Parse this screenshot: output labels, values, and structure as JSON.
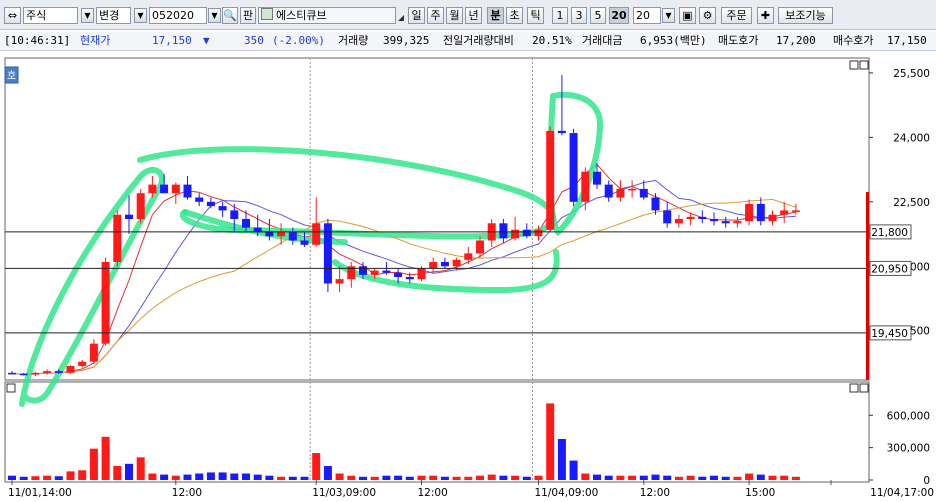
{
  "toolbar": {
    "market": "주식",
    "change_label": "변경",
    "code": "052020",
    "pan_label": "판",
    "stock_name": "에스티큐브",
    "period_buttons": [
      "일",
      "주",
      "월",
      "년",
      "분",
      "초",
      "틱"
    ],
    "minute_buttons": [
      "1",
      "3",
      "5",
      "20"
    ],
    "interval_value": "20",
    "order_label": "주문",
    "aux_label": "보조기능"
  },
  "quote": {
    "time": "[10:46:31]",
    "price_label": "현재가",
    "price": "17,150",
    "change_arrow": "▼",
    "change": "350",
    "change_pct": "(-2.00%)",
    "volume_label": "거래량",
    "volume": "399,325",
    "prev_vol_label": "전일거래량대비",
    "prev_vol_ratio": "20.51%",
    "amount_label": "거래대금",
    "amount": "6,953(백만)",
    "ask_label": "매도호가",
    "ask": "17,200",
    "bid_label": "매수호가",
    "bid": "17,150"
  },
  "chart": {
    "hoga_tab": "호",
    "colors": {
      "up": "#ff1a1a",
      "down": "#1a1aff",
      "highlight": "#33e68c"
    },
    "price_ticks": [
      {
        "value": 25500,
        "label": "25,500"
      },
      {
        "value": 24000,
        "label": "24,000"
      },
      {
        "value": 22500,
        "label": "22,500"
      },
      {
        "value": 21000,
        "label": "21,000"
      },
      {
        "value": 19500,
        "label": "19,500"
      }
    ],
    "price_lines": [
      {
        "value": 21800,
        "label": "21,800"
      },
      {
        "value": 20950,
        "label": "20,950"
      },
      {
        "value": 19450,
        "label": "19,450"
      }
    ],
    "volume_ticks": [
      {
        "value": 600000,
        "label": "600,000"
      },
      {
        "value": 300000,
        "label": "300,000"
      },
      {
        "value": 0,
        "label": "0"
      }
    ],
    "time_labels": [
      {
        "label": "11/01,14:00",
        "index": 0
      },
      {
        "label": "12:00",
        "index": 14
      },
      {
        "label": "11/03,09:00",
        "index": 26
      },
      {
        "label": "12:00",
        "index": 35
      },
      {
        "label": "11/04,09:00",
        "index": 45
      },
      {
        "label": "12:00",
        "index": 54
      },
      {
        "label": "15:00",
        "index": 63
      },
      {
        "label": "11/04,17:00",
        "index": 70
      }
    ]
  },
  "chart_data": {
    "type": "candlestick",
    "price_range": [
      18400,
      25800
    ],
    "volume_range": [
      0,
      760000
    ],
    "candles": [
      [
        18520,
        18560,
        18480,
        18500,
        40000
      ],
      [
        18500,
        18520,
        18460,
        18480,
        30000
      ],
      [
        18480,
        18540,
        18440,
        18520,
        35000
      ],
      [
        18520,
        18600,
        18480,
        18560,
        40000
      ],
      [
        18560,
        18600,
        18500,
        18520,
        35000
      ],
      [
        18520,
        18700,
        18500,
        18680,
        80000
      ],
      [
        18680,
        18820,
        18640,
        18780,
        90000
      ],
      [
        18780,
        19300,
        18720,
        19200,
        290000
      ],
      [
        19200,
        21200,
        19150,
        21100,
        400000
      ],
      [
        21100,
        22300,
        21000,
        22200,
        130000
      ],
      [
        22200,
        22650,
        21750,
        22100,
        150000
      ],
      [
        22100,
        22800,
        22000,
        22700,
        210000
      ],
      [
        22700,
        23100,
        22600,
        22900,
        60000
      ],
      [
        22900,
        23150,
        22700,
        22700,
        50000
      ],
      [
        22700,
        22950,
        22450,
        22900,
        40000
      ],
      [
        22900,
        23100,
        22550,
        22600,
        50000
      ],
      [
        22600,
        22700,
        22400,
        22500,
        60000
      ],
      [
        22500,
        22600,
        22350,
        22400,
        70000
      ],
      [
        22400,
        22500,
        22150,
        22300,
        70000
      ],
      [
        22300,
        22450,
        21800,
        22100,
        60000
      ],
      [
        22100,
        22300,
        21800,
        21900,
        60000
      ],
      [
        21900,
        22200,
        21700,
        21800,
        50000
      ],
      [
        21800,
        22100,
        21600,
        21700,
        40000
      ],
      [
        21700,
        22000,
        21500,
        21800,
        30000
      ],
      [
        21800,
        21900,
        21500,
        21600,
        30000
      ],
      [
        21600,
        21800,
        21450,
        21500,
        30000
      ],
      [
        21500,
        22600,
        21450,
        22000,
        250000
      ],
      [
        22000,
        22100,
        20400,
        20600,
        130000
      ],
      [
        20600,
        21000,
        20400,
        20700,
        60000
      ],
      [
        20700,
        21100,
        20500,
        21000,
        40000
      ],
      [
        21000,
        21100,
        20700,
        20800,
        30000
      ],
      [
        20800,
        20950,
        20700,
        20900,
        30000
      ],
      [
        20900,
        21100,
        20800,
        20850,
        40000
      ],
      [
        20850,
        20950,
        20600,
        20750,
        40000
      ],
      [
        20750,
        20850,
        20600,
        20700,
        30000
      ],
      [
        20700,
        21000,
        20650,
        20950,
        40000
      ],
      [
        20950,
        21200,
        20850,
        21100,
        40000
      ],
      [
        21100,
        21200,
        20950,
        21000,
        30000
      ],
      [
        21000,
        21200,
        20900,
        21150,
        30000
      ],
      [
        21150,
        21450,
        21050,
        21300,
        30000
      ],
      [
        21300,
        21700,
        21200,
        21600,
        40000
      ],
      [
        21600,
        22100,
        21450,
        22000,
        50000
      ],
      [
        22000,
        22100,
        21550,
        21650,
        40000
      ],
      [
        21650,
        22150,
        21600,
        21850,
        40000
      ],
      [
        21850,
        22000,
        21650,
        21700,
        30000
      ],
      [
        21700,
        21950,
        21600,
        21850,
        40000
      ],
      [
        21850,
        24250,
        21800,
        24150,
        710000
      ],
      [
        24150,
        25450,
        24050,
        24100,
        380000
      ],
      [
        24100,
        24200,
        22400,
        22500,
        180000
      ],
      [
        22500,
        23300,
        22300,
        23200,
        60000
      ],
      [
        23200,
        23400,
        22800,
        22900,
        50000
      ],
      [
        22900,
        23000,
        22500,
        22600,
        40000
      ],
      [
        22600,
        23000,
        22500,
        22800,
        40000
      ],
      [
        22800,
        23000,
        22600,
        22800,
        40000
      ],
      [
        22800,
        23000,
        22550,
        22600,
        40000
      ],
      [
        22600,
        22700,
        22200,
        22300,
        50000
      ],
      [
        22300,
        22500,
        21900,
        22000,
        40000
      ],
      [
        22000,
        22200,
        21900,
        22100,
        30000
      ],
      [
        22100,
        22250,
        21950,
        22150,
        40000
      ],
      [
        22150,
        22300,
        22000,
        22100,
        30000
      ],
      [
        22100,
        22250,
        21950,
        22050,
        40000
      ],
      [
        22050,
        22150,
        21900,
        22000,
        30000
      ],
      [
        22000,
        22150,
        21900,
        22050,
        30000
      ],
      [
        22050,
        22550,
        21950,
        22450,
        60000
      ],
      [
        22450,
        22600,
        21950,
        22050,
        50000
      ],
      [
        22050,
        22300,
        21950,
        22200,
        40000
      ],
      [
        22200,
        22500,
        22000,
        22300,
        40000
      ],
      [
        22300,
        22450,
        22200,
        22300,
        30000
      ]
    ]
  }
}
